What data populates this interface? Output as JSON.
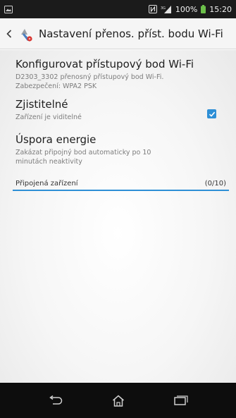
{
  "status_bar": {
    "battery_text": "100%",
    "time": "15:20",
    "icons": [
      "notification-icon",
      "nfc-icon",
      "signal-icon",
      "battery-icon"
    ]
  },
  "action_bar": {
    "title": "Nastavení přenos. příst. bodu Wi-Fi",
    "icons": [
      "back-chevron-icon",
      "hotspot-settings-icon"
    ]
  },
  "preferences": [
    {
      "title": "Konfigurovat přístupový bod Wi-Fi",
      "summary_line1": "D2303_3302 přenosný přístupový bod Wi-Fi.",
      "summary_line2": "Zabezpečení: WPA2 PSK"
    },
    {
      "title": "Zjistitelné",
      "summary": "Zařízení je viditelné",
      "checked": true
    },
    {
      "title": "Úspora energie",
      "summary_line1": "Zakázat připojný bod automaticky po 10",
      "summary_line2": "minutách neaktivity"
    }
  ],
  "connected_devices": {
    "label": "Připojená zařízení",
    "count": "(0/10)"
  },
  "navigation": {
    "icons": [
      "back-icon",
      "home-icon",
      "recent-apps-icon"
    ]
  },
  "colors": {
    "accent": "#2e8fd6",
    "status_bar_bg": "#1b1b1b",
    "nav_bar_bg": "#0d0d0d",
    "battery": "#6cc04a"
  }
}
